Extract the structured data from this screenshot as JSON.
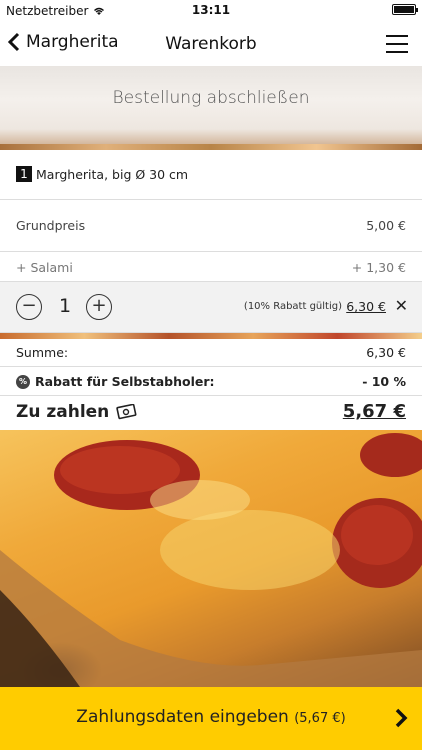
{
  "status_bar": {
    "carrier": "Netzbetreiber",
    "time": "13:11"
  },
  "nav": {
    "back_label": "Margherita",
    "title": "Warenkorb"
  },
  "banner": {
    "title": "Bestellung abschließen"
  },
  "item": {
    "qty_badge": "1",
    "name": "Margherita, big Ø 30 cm"
  },
  "base_price": {
    "label": "Grundpreis",
    "value": "5,00 €"
  },
  "extra": {
    "label": "+ Salami",
    "value": "+ 1,30 €"
  },
  "stepper": {
    "minus": "−",
    "quantity": "1",
    "plus": "+",
    "discount_note": "(10% Rabatt gültig)",
    "line_price": "6,30 €",
    "remove": "✕"
  },
  "summary": {
    "sum_label": "Summe:",
    "sum_value": "6,30 €",
    "rebate_label": "Rabatt für Selbstabholer:",
    "rebate_value": "- 10 %",
    "total_label": "Zu zahlen",
    "total_value": "5,67 €"
  },
  "cta": {
    "label": "Zahlungsdaten eingeben",
    "amount": "(5,67 €)"
  },
  "colors": {
    "cta_bg": "#ffcc00",
    "text": "#222222"
  }
}
